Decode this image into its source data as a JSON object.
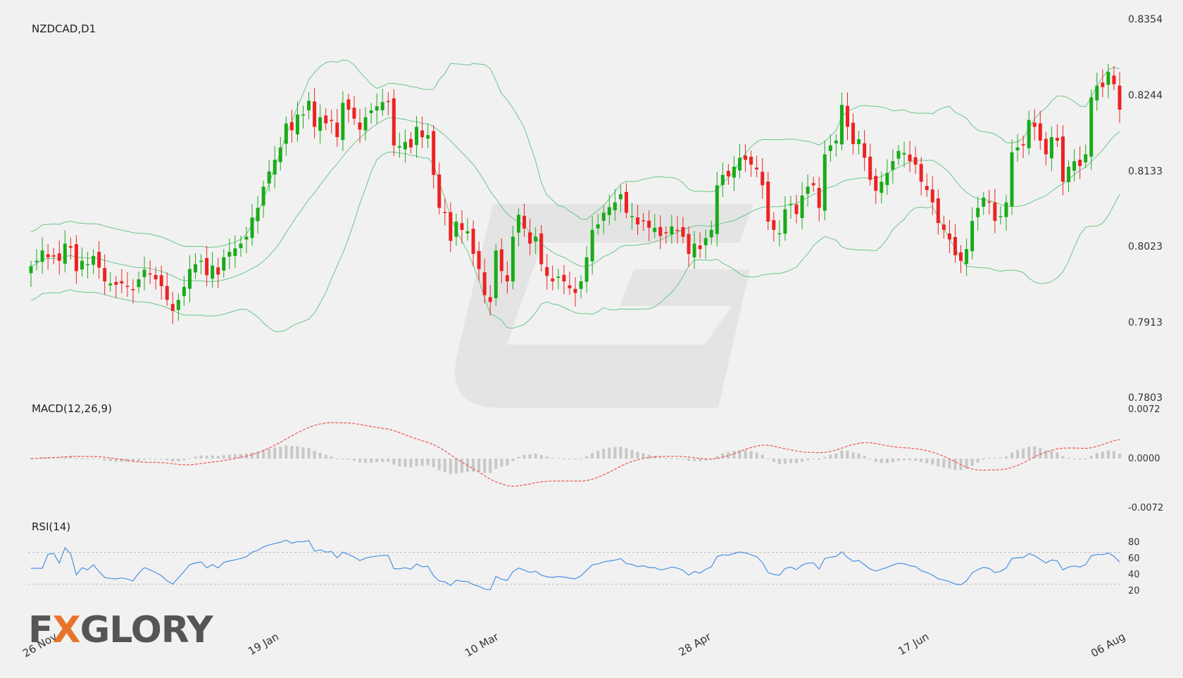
{
  "symbol": "NZDCAD,D1",
  "panels": {
    "macd_title": "MACD(12,26,9)",
    "rsi_title": "RSI(14)"
  },
  "price_axis": {
    "ticks": [
      "0.8354",
      "0.8244",
      "0.8133",
      "0.8023",
      "0.7913",
      "0.7803"
    ],
    "range": [
      0.7803,
      0.8354
    ]
  },
  "macd_axis": {
    "ticks": [
      "0.0072",
      "0.0000",
      "-0.0072"
    ],
    "range": [
      -0.0072,
      0.0072
    ]
  },
  "rsi_axis": {
    "ticks": [
      "80",
      "60",
      "40",
      "20"
    ],
    "levels": [
      70,
      30
    ]
  },
  "date_labels": [
    "26 Nov",
    "19 Jan",
    "10 Mar",
    "28 Apr",
    "17 Jun",
    "06 Aug"
  ],
  "logo": {
    "prefix": "F",
    "accent": "X",
    "suffix": "GLORY"
  },
  "colors": {
    "up": "#1aab1a",
    "down": "#ee2222",
    "bands": "#6cc58a",
    "macd_signal": "#ee5555",
    "macd_hist": "#c8c8c8",
    "rsi": "#4a90e2"
  },
  "chart_data": {
    "type": "candlestick",
    "title": "NZDCAD,D1",
    "date_ticks": [
      {
        "index": 0,
        "label": "26 Nov"
      },
      {
        "index": 37,
        "label": "19 Jan"
      },
      {
        "index": 74,
        "label": "10 Mar"
      },
      {
        "index": 110,
        "label": "28 Apr"
      },
      {
        "index": 147,
        "label": "17 Jun"
      },
      {
        "index": 183,
        "label": "06 Aug"
      }
    ],
    "ohlc_close": [
      0.7997,
      0.8005,
      0.802,
      0.801,
      0.8011,
      0.8005,
      0.803,
      0.8024,
      0.799,
      0.8005,
      0.8,
      0.8012,
      0.7995,
      0.7975,
      0.7972,
      0.797,
      0.7972,
      0.7968,
      0.7962,
      0.7978,
      0.7992,
      0.7986,
      0.7978,
      0.7968,
      0.7948,
      0.7932,
      0.7948,
      0.7967,
      0.7993,
      0.8,
      0.8005,
      0.7984,
      0.7998,
      0.7985,
      0.801,
      0.8018,
      0.8023,
      0.803,
      0.804,
      0.8068,
      0.8082,
      0.8113,
      0.8135,
      0.8152,
      0.817,
      0.8205,
      0.8195,
      0.8218,
      0.8218,
      0.8238,
      0.82,
      0.8214,
      0.8205,
      0.821,
      0.8185,
      0.8235,
      0.8225,
      0.8212,
      0.8196,
      0.8214,
      0.8224,
      0.823,
      0.8236,
      0.8236,
      0.8173,
      0.8172,
      0.8178,
      0.817,
      0.82,
      0.8185,
      0.8188,
      0.813,
      0.8082,
      0.8075,
      0.8034,
      0.8062,
      0.805,
      0.8048,
      0.8015,
      0.7993,
      0.7955,
      0.7945,
      0.802,
      0.799,
      0.7975,
      0.804,
      0.8072,
      0.8052,
      0.803,
      0.804,
      0.8,
      0.7983,
      0.7975,
      0.7982,
      0.7975,
      0.7965,
      0.7958,
      0.7975,
      0.801,
      0.805,
      0.8058,
      0.8075,
      0.8083,
      0.809,
      0.8102,
      0.8075,
      0.807,
      0.8058,
      0.8063,
      0.8053,
      0.8053,
      0.8041,
      0.8046,
      0.8055,
      0.805,
      0.804,
      0.8015,
      0.803,
      0.8022,
      0.8038,
      0.805,
      0.8115,
      0.813,
      0.8128,
      0.8142,
      0.8155,
      0.8152,
      0.8145,
      0.8138,
      0.8115,
      0.8062,
      0.805,
      0.8045,
      0.808,
      0.8088,
      0.8073,
      0.81,
      0.8113,
      0.8115,
      0.8082,
      0.816,
      0.8173,
      0.818,
      0.8232,
      0.82,
      0.8175,
      0.8182,
      0.8155,
      0.8123,
      0.8107,
      0.812,
      0.8133,
      0.815,
      0.8165,
      0.8162,
      0.815,
      0.8145,
      0.812,
      0.8108,
      0.809,
      0.806,
      0.805,
      0.8036,
      0.8013,
      0.8005,
      0.8022,
      0.8063,
      0.8082,
      0.8097,
      0.809,
      0.8063,
      0.807,
      0.809,
      0.8163,
      0.817,
      0.8173,
      0.821,
      0.82,
      0.818,
      0.816,
      0.8185,
      0.818,
      0.812,
      0.8142,
      0.815,
      0.8143,
      0.816,
      0.8243,
      0.826,
      0.8258,
      0.828,
      0.8262,
      0.8225
    ],
    "price_axis_range": [
      0.7803,
      0.8354
    ],
    "series": [
      {
        "name": "MACD(12,26,9)",
        "panel": "macd",
        "ylim": [
          -0.0072,
          0.0072
        ]
      },
      {
        "name": "RSI(14)",
        "panel": "rsi",
        "ylim": [
          0,
          100
        ]
      }
    ],
    "grid": false,
    "legend": "top-left"
  }
}
